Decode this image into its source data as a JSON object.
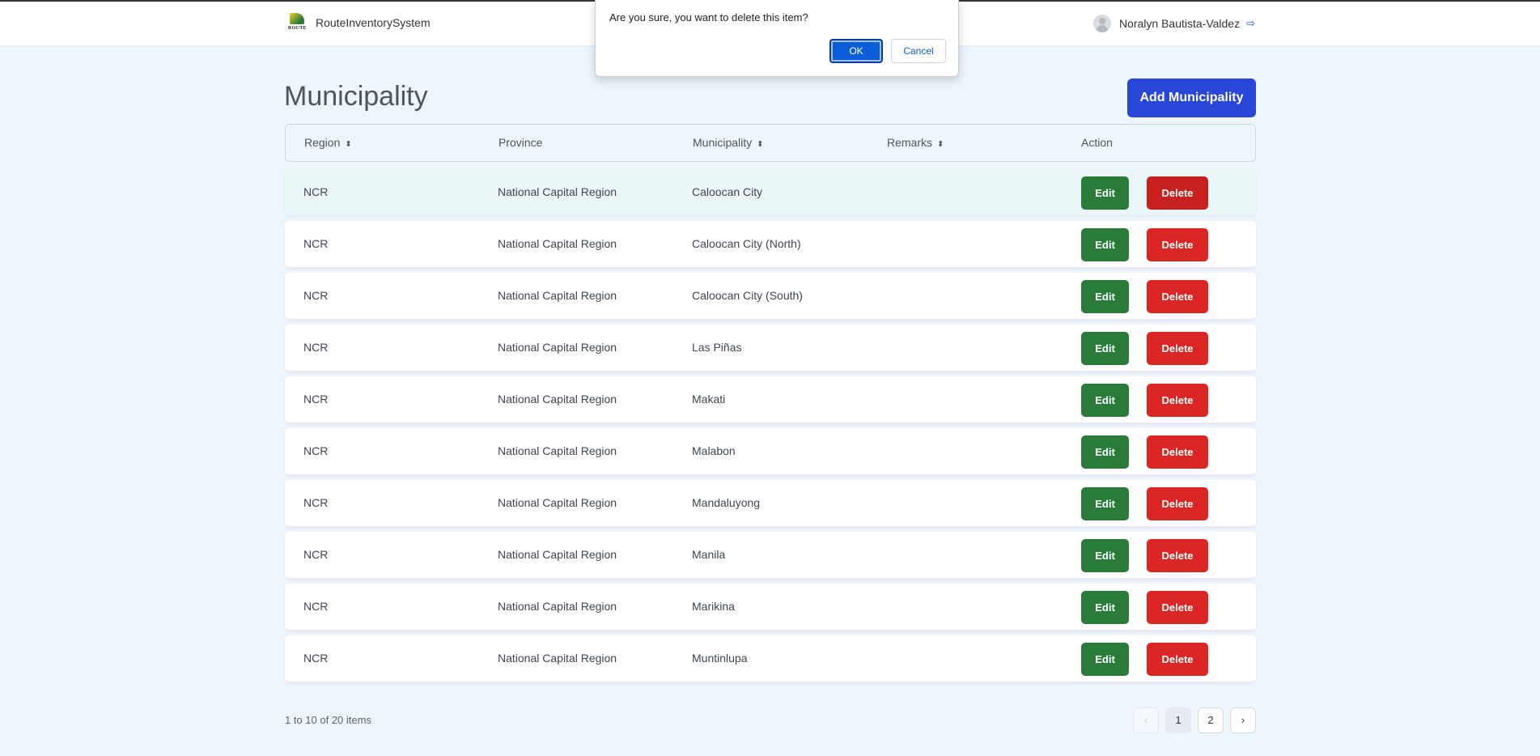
{
  "app": {
    "name": "RouteInventorySystem",
    "logo_text": "ROUTE"
  },
  "user": {
    "name": "Noralyn Bautista-Valdez"
  },
  "dialog": {
    "message": "Are you sure, you want to delete this item?",
    "ok_label": "OK",
    "cancel_label": "Cancel"
  },
  "page": {
    "title": "Municipality",
    "add_label": "Add Municipality"
  },
  "table": {
    "columns": [
      "Region",
      "Province",
      "Municipality",
      "Remarks",
      "Action"
    ],
    "sort_icon": "⬍",
    "edit_label": "Edit",
    "delete_label": "Delete",
    "rows": [
      {
        "region": "NCR",
        "province": "National Capital Region",
        "municipality": "Caloocan City",
        "remarks": ""
      },
      {
        "region": "NCR",
        "province": "National Capital Region",
        "municipality": "Caloocan City (North)",
        "remarks": ""
      },
      {
        "region": "NCR",
        "province": "National Capital Region",
        "municipality": "Caloocan City (South)",
        "remarks": ""
      },
      {
        "region": "NCR",
        "province": "National Capital Region",
        "municipality": "Las Piñas",
        "remarks": ""
      },
      {
        "region": "NCR",
        "province": "National Capital Region",
        "municipality": "Makati",
        "remarks": ""
      },
      {
        "region": "NCR",
        "province": "National Capital Region",
        "municipality": "Malabon",
        "remarks": ""
      },
      {
        "region": "NCR",
        "province": "National Capital Region",
        "municipality": "Mandaluyong",
        "remarks": ""
      },
      {
        "region": "NCR",
        "province": "National Capital Region",
        "municipality": "Manila",
        "remarks": ""
      },
      {
        "region": "NCR",
        "province": "National Capital Region",
        "municipality": "Marikina",
        "remarks": ""
      },
      {
        "region": "NCR",
        "province": "National Capital Region",
        "municipality": "Muntinlupa",
        "remarks": ""
      }
    ]
  },
  "pagination": {
    "summary": "1 to 10 of 20 items",
    "prev": "‹",
    "pages": [
      "1",
      "2"
    ],
    "next": "›",
    "current": "1"
  }
}
